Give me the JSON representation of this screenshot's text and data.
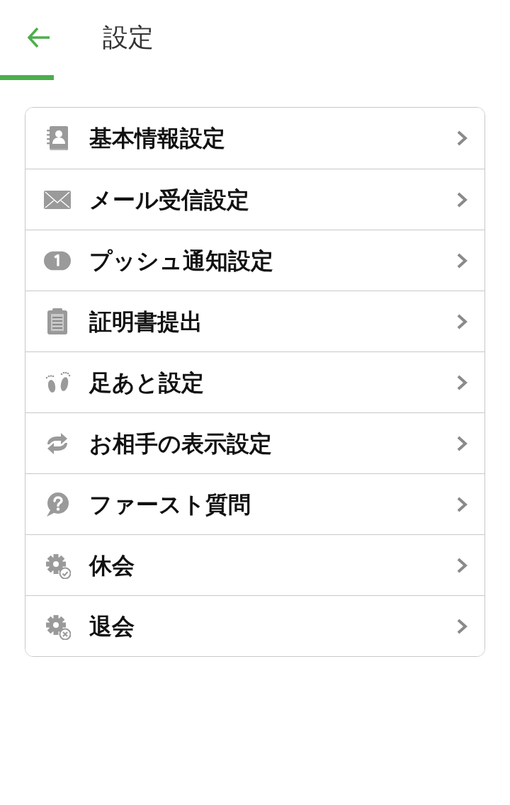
{
  "header": {
    "title": "設定"
  },
  "menu": [
    {
      "label": "基本情報設定",
      "kind": "contacts"
    },
    {
      "label": "メール受信設定",
      "kind": "mail"
    },
    {
      "label": "プッシュ通知設定",
      "kind": "badge"
    },
    {
      "label": "証明書提出",
      "kind": "clipboard"
    },
    {
      "label": "足あと設定",
      "kind": "footprints"
    },
    {
      "label": "お相手の表示設定",
      "kind": "refresh"
    },
    {
      "label": "ファースト質問",
      "kind": "question"
    },
    {
      "label": "休会",
      "kind": "gear-check"
    },
    {
      "label": "退会",
      "kind": "gear-x"
    }
  ]
}
